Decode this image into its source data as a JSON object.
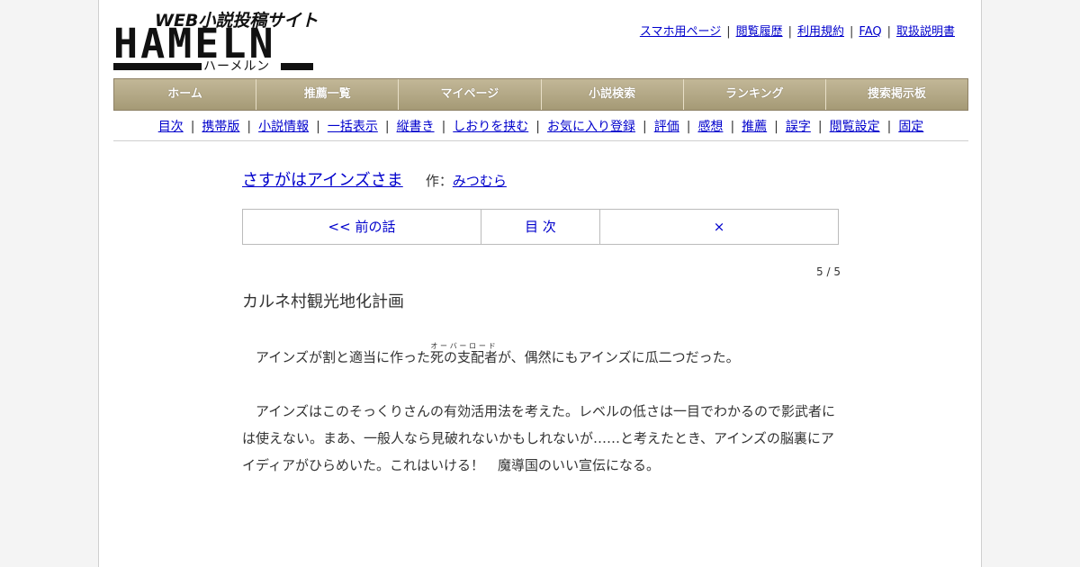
{
  "logo": {
    "tagline": "WEB小説投稿サイト",
    "wordmark": "HAMELN",
    "kana": "ハーメルン"
  },
  "header_links": [
    "スマホ用ページ",
    "閲覧履歴",
    "利用規約",
    "FAQ",
    "取扱説明書"
  ],
  "nav": [
    "ホーム",
    "推薦一覧",
    "マイページ",
    "小説検索",
    "ランキング",
    "捜索掲示板"
  ],
  "subnav": [
    "目次",
    "携帯版",
    "小説情報",
    "一括表示",
    "縦書き",
    "しおりを挟む",
    "お気に入り登録",
    "評価",
    "感想",
    "推薦",
    "誤字",
    "閲覧設定",
    "固定"
  ],
  "novel": {
    "title": "さすがはアインズさま",
    "author_label": "作：",
    "author": "みつむら"
  },
  "pager": {
    "prev": "<< 前の話",
    "toc": "目 次",
    "close": "×"
  },
  "episode": {
    "count": "5 / 5",
    "title": "カルネ村観光地化計画"
  },
  "text": {
    "p1_before": "　アインズが割と適当に作った",
    "p1_ruby_base": "死の支配者",
    "p1_ruby_text": "オーバーロード",
    "p1_after": "が、偶然にもアインズに瓜二つだった。",
    "p2": "　アインズはこのそっくりさんの有効活用法を考えた。レベルの低さは一目でわかるので影武者には使えない。まあ、一般人なら見破れないかもしれないが……と考えたとき、アインズの脳裏にアイディアがひらめいた。これはいける！　魔導国のいい宣伝になる。"
  }
}
